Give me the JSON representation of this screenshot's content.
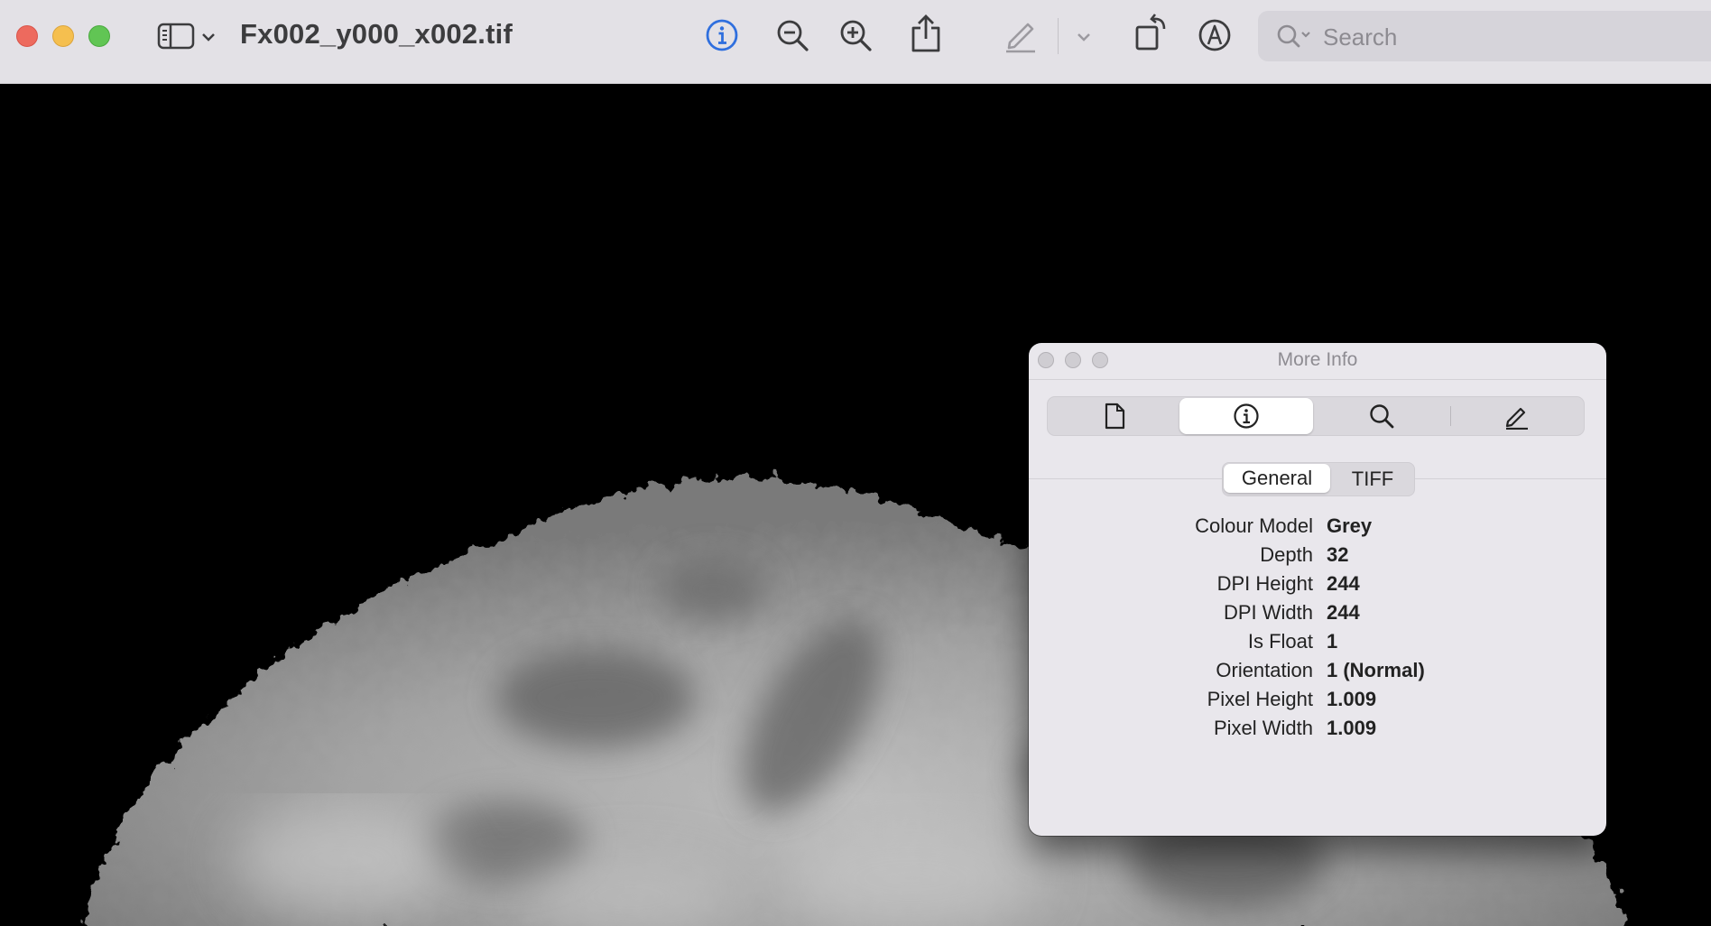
{
  "window": {
    "title": "Fx002_y000_x002.tif"
  },
  "toolbar": {
    "buttons": [
      {
        "name": "sidebar-toggle",
        "icon": "sidebar-icon"
      },
      {
        "name": "sidebar-menu",
        "icon": "chevron-down-icon"
      },
      {
        "name": "info",
        "icon": "info-icon"
      },
      {
        "name": "zoom-out",
        "icon": "zoom-out-icon"
      },
      {
        "name": "zoom-in",
        "icon": "zoom-in-icon"
      },
      {
        "name": "share",
        "icon": "share-icon"
      },
      {
        "name": "highlight",
        "icon": "pencil-icon"
      },
      {
        "name": "highlight-menu",
        "icon": "chevron-down-icon"
      },
      {
        "name": "rotate",
        "icon": "rotate-icon"
      },
      {
        "name": "markup",
        "icon": "markup-icon"
      }
    ],
    "accent_color": "#2f6fde"
  },
  "search": {
    "placeholder": "Search",
    "value": ""
  },
  "info_panel": {
    "title": "More Info",
    "tabs": [
      {
        "icon": "document-icon",
        "active": false
      },
      {
        "icon": "info-icon",
        "active": true
      },
      {
        "icon": "magnifier-icon",
        "active": false
      },
      {
        "icon": "pencil-icon",
        "active": false
      }
    ],
    "subtabs": [
      "General",
      "TIFF"
    ],
    "active_subtab": "General",
    "properties": [
      {
        "label": "Colour Model",
        "value": "Grey"
      },
      {
        "label": "Depth",
        "value": "32"
      },
      {
        "label": "DPI Height",
        "value": "244"
      },
      {
        "label": "DPI Width",
        "value": "244"
      },
      {
        "label": "Is Float",
        "value": "1"
      },
      {
        "label": "Orientation",
        "value": "1 (Normal)"
      },
      {
        "label": "Pixel Height",
        "value": "1.009"
      },
      {
        "label": "Pixel Width",
        "value": "1.009"
      }
    ]
  }
}
